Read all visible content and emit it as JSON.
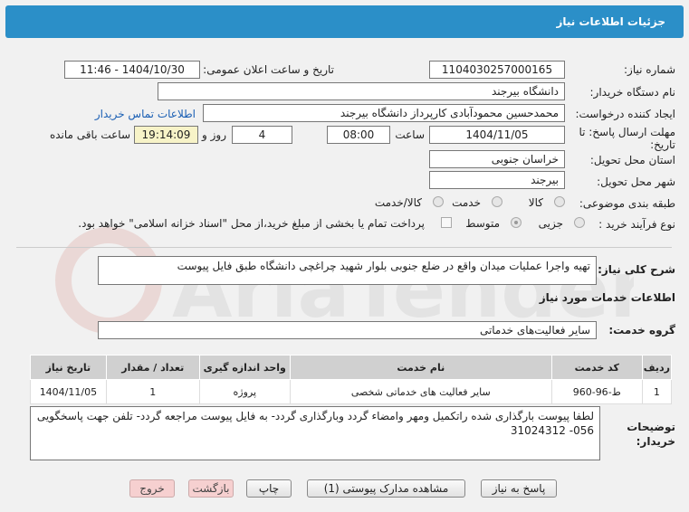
{
  "header": {
    "title": "جزئیات اطلاعات نیاز"
  },
  "fields": {
    "need_number_label": "شماره نیاز:",
    "need_number": "1104030257000165",
    "announce_label": "تاریخ و ساعت اعلان عمومی:",
    "announce_value": "1404/10/30 - 11:46",
    "buyer_label": "نام دستگاه خریدار:",
    "buyer_value": "دانشگاه بیرجند",
    "creator_label": "ایجاد کننده درخواست:",
    "creator_value": "محمدحسین محمودآبادی کارپرداز دانشگاه بیرجند",
    "contact_link": "اطلاعات تماس خریدار",
    "deadline_label_1": "مهلت ارسال پاسخ: تا",
    "deadline_label_2": "تاریخ:",
    "deadline_date": "1404/11/05",
    "time_label": "ساعت",
    "deadline_time": "08:00",
    "days_value": "4",
    "days_label": "روز و",
    "remaining_time": "19:14:09",
    "remaining_label": "ساعت باقی مانده",
    "province_label": "استان محل تحویل:",
    "province_value": "خراسان جنوبی",
    "city_label": "شهر محل تحویل:",
    "city_value": "بیرجند",
    "category_label": "طبقه بندی موضوعی:",
    "category_options": [
      "کالا",
      "خدمت",
      "کالا/خدمت"
    ],
    "process_label": "نوع فرآیند خرید :",
    "process_options": [
      "جزیی",
      "متوسط"
    ],
    "payment_note": "پرداخت تمام یا بخشی از مبلغ خرید،از محل \"اسناد خزانه اسلامی\" خواهد بود."
  },
  "description": {
    "label": "شرح کلی نیاز:",
    "value": "تهیه واجرا عملیات میدان واقع در ضلع جنوبی بلوار شهید چراغچی دانشگاه طبق فایل پیوست"
  },
  "services": {
    "title": "اطلاعات خدمات مورد نیاز",
    "group_label": "گروه خدمت:",
    "group_value": "سایر فعالیت‌های خدماتی",
    "columns": [
      "ردیف",
      "کد خدمت",
      "نام خدمت",
      "واحد اندازه گیری",
      "تعداد / مقدار",
      "تاریخ نیاز"
    ],
    "rows": [
      {
        "row": "1",
        "code": "ط-96-960",
        "name": "سایر فعالیت های خدماتی شخصی",
        "unit": "پروژه",
        "qty": "1",
        "date": "1404/11/05"
      }
    ]
  },
  "buyer_notes": {
    "label_1": "توضیحات",
    "label_2": "خریدار:",
    "value": "لطفا پیوست بارگذاری شده راتکمیل ومهر وامضاء گردد وبارگذاری گردد- به فایل پیوست مراجعه گردد- تلفن جهت پاسخگویی 056- 31024312"
  },
  "buttons": {
    "reply": "پاسخ به نیاز",
    "attachments": "مشاهده مدارک پیوستی (1)",
    "print": "چاپ",
    "back": "بازگشت",
    "exit": "خروج"
  },
  "watermark": "AriaTender.net",
  "colors": {
    "header": "#2b8fc8",
    "link": "#1a5fb4",
    "yellow": "#f7f3c8",
    "exit_button": "#f6d0d0"
  }
}
